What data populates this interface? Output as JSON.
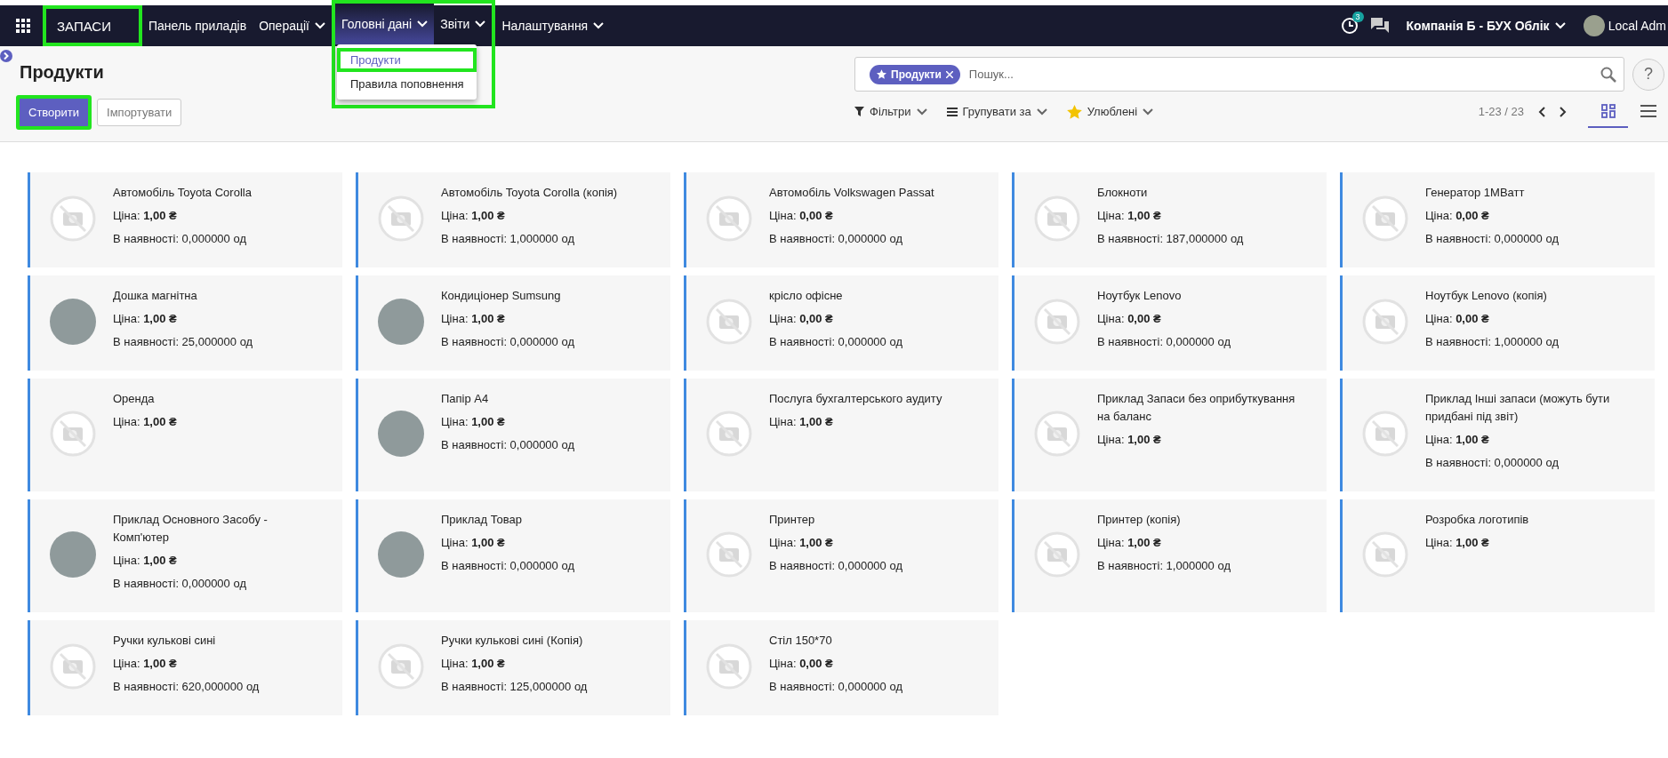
{
  "navbar": {
    "brand": {
      "label": "ЗАПАСИ",
      "highlighted": true
    },
    "menu": [
      {
        "label": "Панель приладів",
        "has_caret": false,
        "active": false,
        "highlighted": false
      },
      {
        "label": "Операції",
        "has_caret": true,
        "active": false,
        "highlighted": false
      },
      {
        "label": "Головні дані",
        "has_caret": true,
        "active": true,
        "highlighted": true,
        "dropdown": [
          {
            "label": "Продукти",
            "selected": true,
            "highlighted": true
          },
          {
            "label": "Правила поповнення",
            "selected": false,
            "highlighted": false
          }
        ]
      },
      {
        "label": "Звіти",
        "has_caret": true,
        "active": false,
        "highlighted": true
      },
      {
        "label": "Налаштування",
        "has_caret": true,
        "active": false,
        "highlighted": false
      }
    ],
    "activity_badge": "3",
    "company": "Компанія Б - БУХ Облік",
    "user": "Local Adm"
  },
  "control_panel": {
    "title": "Продукти",
    "create_button": {
      "label": "Створити",
      "highlighted": true
    },
    "import_button": "Імпортувати",
    "search": {
      "facet": "Продукти",
      "placeholder": "Пошук..."
    },
    "filters": [
      {
        "kind": "filter",
        "label": "Фільтри"
      },
      {
        "kind": "group",
        "label": "Групувати за"
      },
      {
        "kind": "favorite",
        "label": "Улюблені"
      }
    ],
    "pager": "1-23 / 23",
    "help_button": "?",
    "views": [
      {
        "kind": "kanban",
        "selected": true
      },
      {
        "kind": "list",
        "selected": false
      }
    ]
  },
  "products": [
    {
      "name": "Автомобіль Toyota Corolla",
      "price": "Ціна: **1,00 ₴**",
      "stock": "В наявності: 0,000000 од",
      "kind": "placeholder"
    },
    {
      "name": "Автомобіль Toyota Corolla (копія)",
      "price": "Ціна: **1,00 ₴**",
      "stock": "В наявності: 1,000000 од",
      "kind": "placeholder"
    },
    {
      "name": "Автомобіль Volkswagen Passat",
      "price": "Ціна: **0,00 ₴**",
      "stock": "В наявності: 0,000000 од",
      "kind": "placeholder"
    },
    {
      "name": "Блокноти",
      "price": "Ціна: **1,00 ₴**",
      "stock": "В наявності: 187,000000 од",
      "kind": "placeholder"
    },
    {
      "name": "Генератор 1МВатт",
      "price": "Ціна: **0,00 ₴**",
      "stock": "В наявності: 0,000000 од",
      "kind": "placeholder"
    },
    {
      "name": "Дошка магнітна",
      "price": "Ціна: **1,00 ₴**",
      "stock": "В наявності: 25,000000 од",
      "kind": "photo"
    },
    {
      "name": "Кондиціонер Sumsung",
      "price": "Ціна: **1,00 ₴**",
      "stock": "В наявності: 0,000000 од",
      "kind": "photo"
    },
    {
      "name": "крісло офісне",
      "price": "Ціна: **0,00 ₴**",
      "stock": "В наявності: 0,000000 од",
      "kind": "placeholder"
    },
    {
      "name": "Ноутбук Lenovo",
      "price": "Ціна: **0,00 ₴**",
      "stock": "В наявності: 0,000000 од",
      "kind": "placeholder"
    },
    {
      "name": "Ноутбук Lenovo (копія)",
      "price": "Ціна: **0,00 ₴**",
      "stock": "В наявності: 1,000000 од",
      "kind": "placeholder"
    },
    {
      "name": "Оренда",
      "price": "Ціна: **1,00 ₴**",
      "kind": "placeholder"
    },
    {
      "name": "Папір А4",
      "price": "Ціна: **1,00 ₴**",
      "stock": "В наявності: 0,000000 од",
      "kind": "photo"
    },
    {
      "name": "Послуга бухгалтерського аудиту",
      "price": "Ціна: **1,00 ₴**",
      "kind": "placeholder"
    },
    {
      "name": "Приклад Запаси без оприбуткування на баланс",
      "price": "Ціна: **1,00 ₴**",
      "kind": "placeholder"
    },
    {
      "name": "Приклад Інші запаси (можуть бути придбані під звіт)",
      "price": "Ціна: **1,00 ₴**",
      "stock": "В наявності: 0,000000 од",
      "kind": "placeholder"
    },
    {
      "name": "Приклад Основного Засобу - Комп'ютер",
      "price": "Ціна: **1,00 ₴**",
      "stock": "В наявності: 0,000000 од",
      "kind": "photo"
    },
    {
      "name": "Приклад Товар",
      "price": "Ціна: **1,00 ₴**",
      "stock": "В наявності: 0,000000 од",
      "kind": "photo"
    },
    {
      "name": "Принтер",
      "price": "Ціна: **1,00 ₴**",
      "stock": "В наявності: 0,000000 од",
      "kind": "placeholder"
    },
    {
      "name": "Принтер (копія)",
      "price": "Ціна: **1,00 ₴**",
      "stock": "В наявності: 1,000000 од",
      "kind": "placeholder"
    },
    {
      "name": "Розробка логотипів",
      "price": "Ціна: **1,00 ₴**",
      "kind": "placeholder"
    },
    {
      "name": "Ручки кулькові сині",
      "price": "Ціна: **1,00 ₴**",
      "stock": "В наявності: 620,000000 од",
      "kind": "placeholder"
    },
    {
      "name": "Ручки кулькові сині (Копія)",
      "price": "Ціна: **1,00 ₴**",
      "stock": "В наявності: 125,000000 од",
      "kind": "placeholder"
    },
    {
      "name": "Стіл 150*70",
      "price": "Ціна: **0,00 ₴**",
      "stock": "В наявності: 0,000000 од",
      "kind": "placeholder"
    }
  ]
}
